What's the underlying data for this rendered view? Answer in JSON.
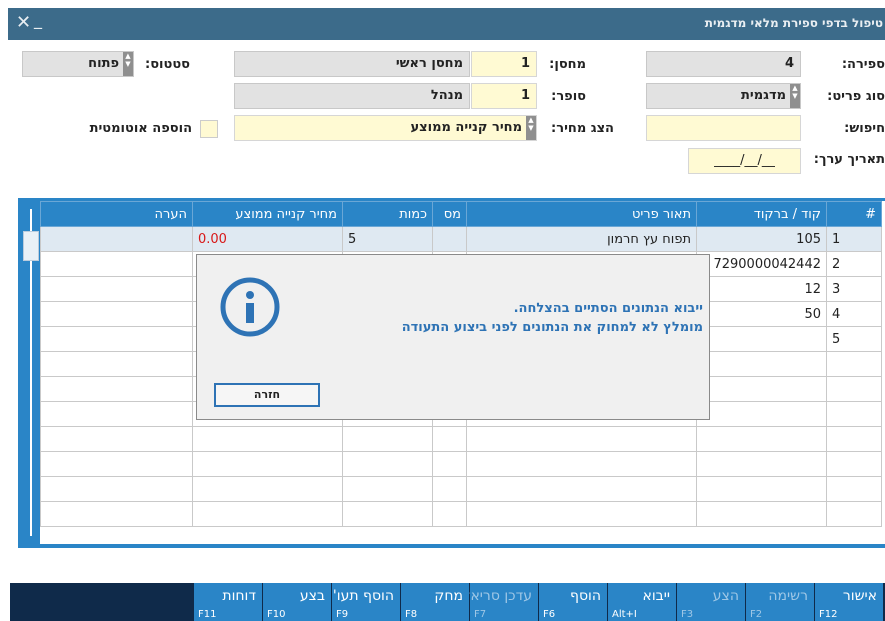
{
  "window": {
    "title": "טיפול בדפי ספירת מלאי מדגמית",
    "close_glyph": "✕",
    "minimize_glyph": "_"
  },
  "form": {
    "count_label": "ספירה:",
    "count_value": "4",
    "warehouse_label": "מחסן:",
    "warehouse_code": "1",
    "warehouse_name": "מחסן ראשי",
    "status_label": "סטטוס:",
    "status_value": "פתוח",
    "item_type_label": "סוג פריט:",
    "item_type_value": "מדגמית",
    "counter_label": "סופר:",
    "counter_code": "1",
    "counter_name": "מנהל",
    "search_label": "חיפוש:",
    "search_value": "",
    "show_price_label": "הצג מחיר:",
    "show_price_value": "מחיר קנייה ממוצע",
    "auto_add_label": "הוספה אוטומטית",
    "auto_add_checked": false,
    "value_date_label": "תאריך ערך:",
    "value_date_value": "__/__/____"
  },
  "grid": {
    "columns": [
      "#",
      "קוד / ברקוד",
      "תאור פריט",
      "מס",
      "כמות",
      "מחיר קנייה ממוצע",
      "הערה"
    ],
    "rows": [
      {
        "num": "1",
        "code": "105",
        "desc": "תפוח עץ חרמון",
        "tax": "",
        "qty": "5",
        "price": "0.00",
        "note": ""
      },
      {
        "num": "2",
        "code": "7290000042442",
        "desc": "",
        "tax": "",
        "qty": "",
        "price": "",
        "note": ""
      },
      {
        "num": "3",
        "code": "12",
        "desc": "",
        "tax": "",
        "qty": "",
        "price": "",
        "note": ""
      },
      {
        "num": "4",
        "code": "50",
        "desc": "",
        "tax": "",
        "qty": "",
        "price": "",
        "note": ""
      },
      {
        "num": "5",
        "code": "",
        "desc": "",
        "tax": "",
        "qty": "",
        "price": "",
        "note": ""
      },
      {
        "num": "",
        "code": "",
        "desc": "",
        "tax": "",
        "qty": "",
        "price": "",
        "note": ""
      },
      {
        "num": "",
        "code": "",
        "desc": "",
        "tax": "",
        "qty": "",
        "price": "",
        "note": ""
      },
      {
        "num": "",
        "code": "",
        "desc": "",
        "tax": "",
        "qty": "",
        "price": "",
        "note": ""
      },
      {
        "num": "",
        "code": "",
        "desc": "",
        "tax": "",
        "qty": "",
        "price": "",
        "note": ""
      },
      {
        "num": "",
        "code": "",
        "desc": "",
        "tax": "",
        "qty": "",
        "price": "",
        "note": ""
      },
      {
        "num": "",
        "code": "",
        "desc": "",
        "tax": "",
        "qty": "",
        "price": "",
        "note": ""
      },
      {
        "num": "",
        "code": "",
        "desc": "",
        "tax": "",
        "qty": "",
        "price": "",
        "note": ""
      }
    ]
  },
  "dialog": {
    "line1": "ייבוא הנתונים הסתיים בהצלחה.",
    "line2": "מומלץ לא למחוק את הנתונים לפני ביצוע התעודה",
    "button": "חזרה",
    "icon": "info-icon"
  },
  "fkeys": [
    {
      "label": "אישור",
      "key": "F12",
      "enabled": true
    },
    {
      "label": "רשימה",
      "key": "F2",
      "enabled": false
    },
    {
      "label": "הצע",
      "key": "F3",
      "enabled": false
    },
    {
      "label": "ייבוא",
      "key": "Alt+I",
      "enabled": true
    },
    {
      "label": "הוסף",
      "key": "F6",
      "enabled": true
    },
    {
      "label": "עדכן סריאלים",
      "key": "F7",
      "enabled": false
    },
    {
      "label": "מחק",
      "key": "F8",
      "enabled": true
    },
    {
      "label": "הוסף תעו'",
      "key": "F9",
      "enabled": true
    },
    {
      "label": "בצע",
      "key": "F10",
      "enabled": true
    },
    {
      "label": "דוחות",
      "key": "F11",
      "enabled": true
    }
  ],
  "colors": {
    "accent": "#2a85c7",
    "title": "#3c6b8a",
    "dialog_text": "#2e73b5",
    "price_red": "#d81818"
  }
}
